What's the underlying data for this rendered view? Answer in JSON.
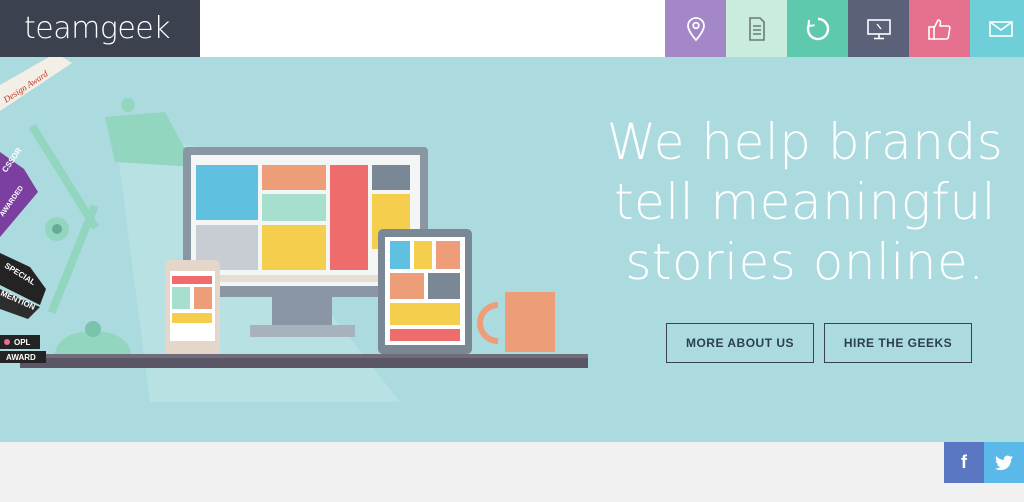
{
  "brand": {
    "logo_text": "teamgeek"
  },
  "nav": {
    "items": [
      {
        "icon": "location-pin-icon",
        "color": "#a487c6"
      },
      {
        "icon": "document-icon",
        "color": "#c9ecdc"
      },
      {
        "icon": "refresh-circle-icon",
        "color": "#5fc9ae"
      },
      {
        "icon": "monitor-icon",
        "color": "#5b6178"
      },
      {
        "icon": "thumbs-up-icon",
        "color": "#e5718f"
      },
      {
        "icon": "envelope-icon",
        "color": "#6fcfd8"
      }
    ]
  },
  "hero": {
    "headline": [
      "We help brands",
      "tell meaningful",
      "stories online."
    ],
    "buttons": {
      "more": "MORE ABOUT US",
      "hire": "HIRE THE GEEKS"
    },
    "background_color": "#acdbdf"
  },
  "awards": {
    "design_award": "Design Award",
    "cssdr": "CSSDR",
    "awarded": "AWARDED",
    "special": "SPECIAL",
    "mention": "MENTION",
    "opl": "OPL",
    "award": "AWARD"
  },
  "social": {
    "facebook": "f",
    "twitter": "twitter-bird-icon"
  }
}
